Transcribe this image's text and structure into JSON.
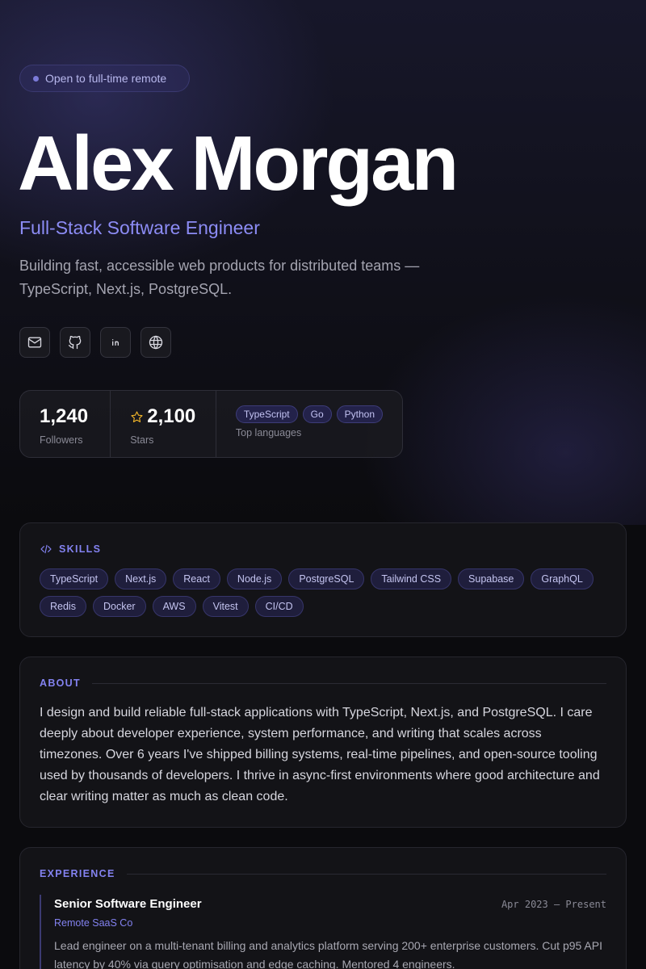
{
  "hero": {
    "status": "Open to full-time remote",
    "name": "Alex Morgan",
    "role": "Full-Stack Software Engineer",
    "tagline": "Building fast, accessible web products for distributed teams — TypeScript, Next.js, PostgreSQL.",
    "social_icons": [
      "mail-icon",
      "github-icon",
      "linkedin-icon",
      "globe-icon"
    ]
  },
  "stats": {
    "followers_value": "1,240",
    "followers_label": "Followers",
    "stars_value": "2,100",
    "stars_label": "Stars",
    "languages": [
      "TypeScript",
      "Go",
      "Python"
    ],
    "languages_label": "Top languages"
  },
  "skills": {
    "heading": "SKILLS",
    "items": [
      "TypeScript",
      "Next.js",
      "React",
      "Node.js",
      "PostgreSQL",
      "Tailwind CSS",
      "Supabase",
      "GraphQL",
      "Redis",
      "Docker",
      "AWS",
      "Vitest",
      "CI/CD"
    ]
  },
  "about": {
    "heading": "ABOUT",
    "text": "I design and build reliable full-stack applications with TypeScript, Next.js, and PostgreSQL. I care deeply about developer experience, system performance, and writing that scales across timezones. Over 6 years I've shipped billing systems, real-time pipelines, and open-source tooling used by thousands of developers. I thrive in async-first environments where good architecture and clear writing matter as much as clean code."
  },
  "experience": {
    "heading": "EXPERIENCE",
    "items": [
      {
        "title": "Senior Software Engineer",
        "company": "Remote SaaS Co",
        "dates": "Apr 2023 — Present",
        "description": "Lead engineer on a multi-tenant billing and analytics platform serving 200+ enterprise customers. Cut p95 API latency by 40% via query optimisation and edge caching. Mentored 4 engineers."
      }
    ]
  },
  "colors": {
    "accent": "#8382f0",
    "background": "#0b0b0e",
    "star": "#f0b429"
  }
}
